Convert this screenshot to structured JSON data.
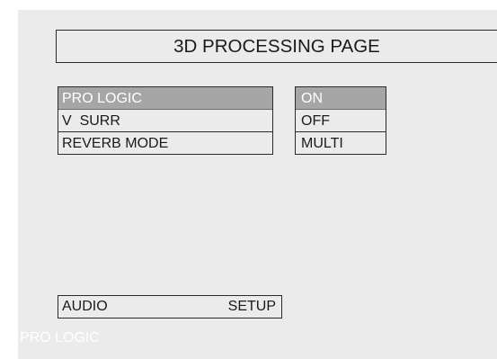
{
  "page": {
    "title": "3D PROCESSING PAGE"
  },
  "menu": {
    "items": [
      {
        "label": "PRO LOGIC",
        "selected": true
      },
      {
        "label": "V  SURR",
        "selected": false
      },
      {
        "label": "REVERB MODE",
        "selected": false
      }
    ]
  },
  "options": {
    "items": [
      {
        "label": "ON",
        "selected": true
      },
      {
        "label": "OFF",
        "selected": false
      },
      {
        "label": "MULTI",
        "selected": false
      }
    ]
  },
  "bottom_bar": {
    "left_label": "AUDIO",
    "right_label": "SETUP"
  },
  "status": {
    "text": "PRO LOGIC"
  },
  "colors": {
    "screen_background": "#ebebeb",
    "highlight": "#a6a6a6",
    "highlight_text": "#ffffff",
    "border": "#2a2a2a"
  }
}
